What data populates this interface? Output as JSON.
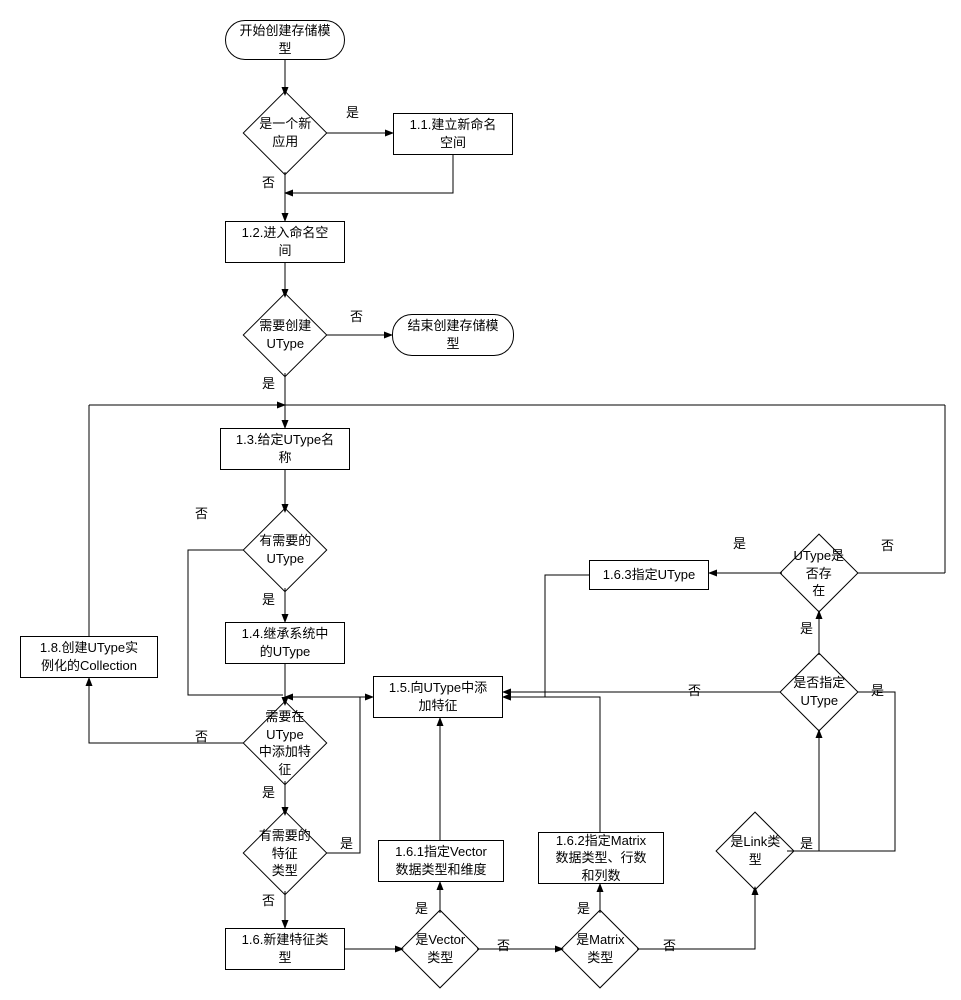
{
  "nodes": {
    "start": "开始创建存储模\n型",
    "d_new_app": "是一个新应用",
    "p_1_1": "1.1.建立新命名\n空间",
    "p_1_2": "1.2.进入命名空\n间",
    "d_need_utype": "需要创建\nUType",
    "end": "结束创建存储模\n型",
    "p_1_3": "1.3.给定UType名\n称",
    "d_has_utype": "有需要的\nUType",
    "p_1_4": "1.4.继承系统中\n的UType",
    "p_1_8": "1.8.创建UType实\n例化的Collection",
    "p_1_5": "1.5.向UType中添\n加特征",
    "d_add_feature": "需要在UType\n中添加特征",
    "d_has_ftype": "有需要的特征\n类型",
    "p_1_6": "1.6.新建特征类\n型",
    "p_1_6_1": "1.6.1指定Vector\n数据类型和维度",
    "p_1_6_2": "1.6.2指定Matrix\n数据类型、行数\n和列数",
    "p_1_6_3": "1.6.3指定UType",
    "d_is_vector": "是Vector类型",
    "d_is_matrix": "是Matrix类型",
    "d_is_link": "是Link类型",
    "d_assign_utype": "是否指定\nUType",
    "d_utype_exists": "UType是否存\n在"
  },
  "labels": {
    "yes": "是",
    "no": "否"
  }
}
